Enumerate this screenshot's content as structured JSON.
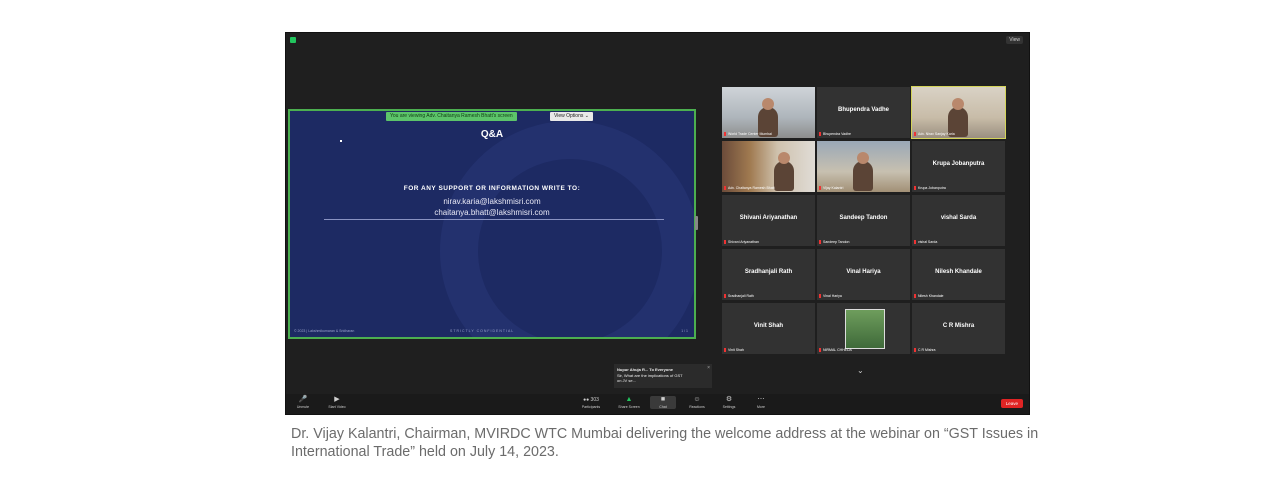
{
  "app": {
    "sharing_banner": "You are viewing Adv. Chaitanya Ramesh Bhatt's screen",
    "view_options_label": "View Options ⌄",
    "view_label": "View"
  },
  "slide": {
    "title": "Q&A",
    "support_heading": "FOR ANY SUPPORT OR INFORMATION WRITE TO:",
    "email_1": "nirav.karia@lakshmisri.com",
    "email_2": "chaitanya.bhatt@lakshmisri.com",
    "footer_left": "© 2023 | Lakshmikumaran & Sridharan",
    "footer_center": "STRICTLY CONFIDENTIAL",
    "footer_right": "1 / 1"
  },
  "participants": [
    {
      "name": "Vijay Kalantri",
      "label": "World Trade Center Mumbai",
      "video": "room"
    },
    {
      "name": "Bhupendra Vadhe",
      "label": "Bhupendra Vadhe",
      "video": null
    },
    {
      "name": "Nirav Sanjay Karia",
      "label": "Adv. Nirav Sanjay Karia",
      "video": "office"
    },
    {
      "name": "Chaitanya Ramesh Bhatt",
      "label": "Adv. Chaitanya Ramesh Bhatt",
      "video": "books"
    },
    {
      "name": "Vijay Kalantri",
      "label": "Vijay Kalantri",
      "video": "study"
    },
    {
      "name": "Krupa Jobanputra",
      "label": "Krupa Jobanputra",
      "video": null
    },
    {
      "name": "Shivani Ariyanathan",
      "label": "Shivani Ariyanathan",
      "video": null
    },
    {
      "name": "Sandeep Tandon",
      "label": "Sandeep Tandon",
      "video": null
    },
    {
      "name": "vishal Sarda",
      "label": "vishal Sarda",
      "video": null
    },
    {
      "name": "Sradhanjali Rath",
      "label": "Sradhanjali Rath",
      "video": null
    },
    {
      "name": "Vinal Hariya",
      "label": "Vinal Hariya",
      "video": null
    },
    {
      "name": "Nilesh Khandale",
      "label": "Nilesh Khandale",
      "video": null
    },
    {
      "name": "Vinit Shah",
      "label": "Vinit Shah",
      "video": null
    },
    {
      "name": "NIRMAL CHHEDA",
      "label": "NIRMAL CHHEDA",
      "video": "photo"
    },
    {
      "name": "C R Mishra",
      "label": "C R Mishra",
      "video": null
    }
  ],
  "chat_popup": {
    "from": "Nupur Ahuja R... To Everyone",
    "message": "Sir, What are the implications of GST on JV se..."
  },
  "toolbar": {
    "unmute": "Unmute",
    "start_video": "Start Video",
    "participants": "Participants",
    "participants_count": "303",
    "share_screen": "Share Screen",
    "chat": "Chat",
    "reactions": "Reactions",
    "settings": "Settings",
    "more": "More",
    "leave": "Leave"
  },
  "caption": "Dr. Vijay Kalantri, Chairman, MVIRDC WTC Mumbai delivering the welcome address at the webinar on “GST Issues in International Trade” held on July 14, 2023."
}
